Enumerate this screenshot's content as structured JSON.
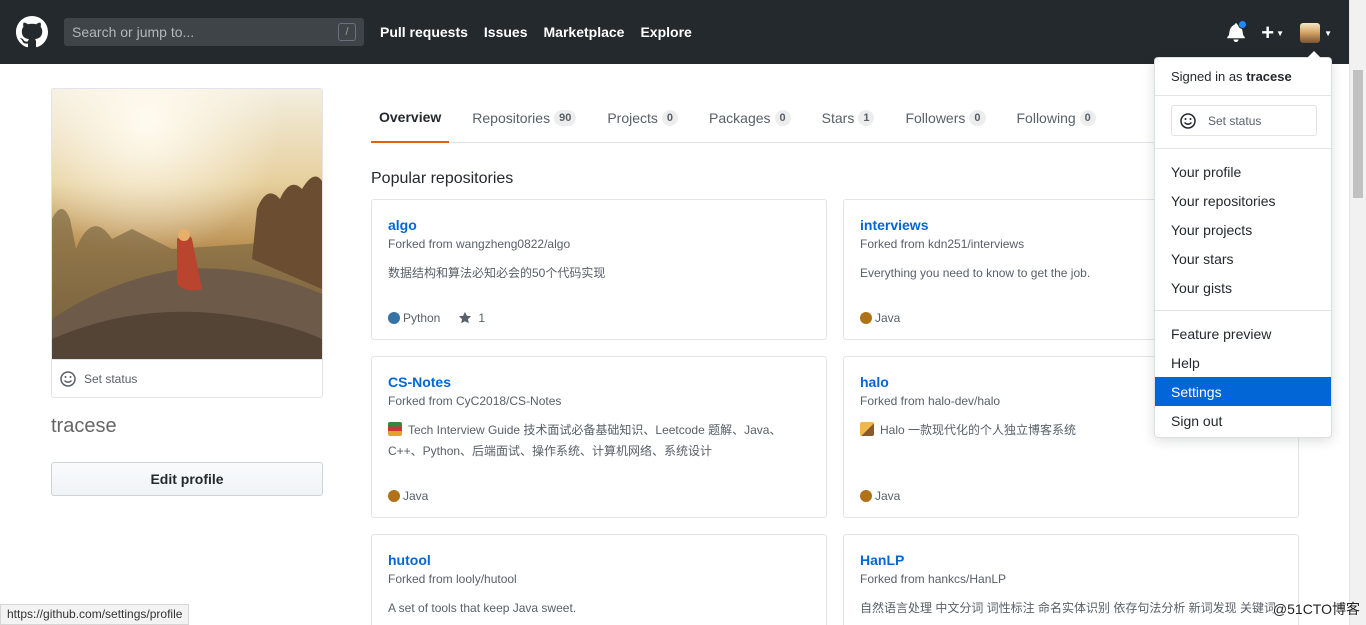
{
  "header": {
    "search_placeholder": "Search or jump to...",
    "search_shortcut": "/",
    "nav": [
      "Pull requests",
      "Issues",
      "Marketplace",
      "Explore"
    ],
    "notification_dot_color": "#2188ff",
    "new_label": "+"
  },
  "profile": {
    "set_status": "Set status",
    "username": "tracese",
    "edit_profile": "Edit profile"
  },
  "tabs": [
    {
      "label": "Overview",
      "count": null,
      "selected": true
    },
    {
      "label": "Repositories",
      "count": "90"
    },
    {
      "label": "Projects",
      "count": "0"
    },
    {
      "label": "Packages",
      "count": "0"
    },
    {
      "label": "Stars",
      "count": "1"
    },
    {
      "label": "Followers",
      "count": "0"
    },
    {
      "label": "Following",
      "count": "0"
    }
  ],
  "popular_title": "Popular repositories",
  "repos": [
    {
      "name": "algo",
      "fork": "Forked from wangzheng0822/algo",
      "desc": "数据结构和算法必知必会的50个代码实现",
      "lang": "Python",
      "lang_color": "#3572A5",
      "stars": "1"
    },
    {
      "name": "interviews",
      "fork": "Forked from kdn251/interviews",
      "desc": "Everything you need to know to get the job.",
      "lang": "Java",
      "lang_color": "#b07219"
    },
    {
      "name": "CS-Notes",
      "fork": "Forked from CyC2018/CS-Notes",
      "desc": "Tech Interview Guide 技术面试必备基础知识、Leetcode 题解、Java、C++、Python、后端面试、操作系统、计算机网络、系统设计",
      "lang": "Java",
      "lang_color": "#b07219",
      "emoji": "books"
    },
    {
      "name": "halo",
      "fork": "Forked from halo-dev/halo",
      "desc": "Halo 一款现代化的个人独立博客系统",
      "lang": "Java",
      "lang_color": "#b07219",
      "emoji": "writing-hand"
    },
    {
      "name": "hutool",
      "fork": "Forked from looly/hutool",
      "desc": "A set of tools that keep Java sweet."
    },
    {
      "name": "HanLP",
      "fork": "Forked from hankcs/HanLP",
      "desc": "自然语言处理 中文分词 词性标注 命名实体识别 依存句法分析 新词发现 关键词"
    }
  ],
  "dropdown": {
    "signed_in_prefix": "Signed in as",
    "signed_in_user": "tracese",
    "set_status": "Set status",
    "group1": [
      "Your profile",
      "Your repositories",
      "Your projects",
      "Your stars",
      "Your gists"
    ],
    "group2": [
      "Feature preview",
      "Help",
      "Settings",
      "Sign out"
    ],
    "active_item": "Settings"
  },
  "status_url": "https://github.com/settings/profile",
  "watermark": "@51CTO博客"
}
